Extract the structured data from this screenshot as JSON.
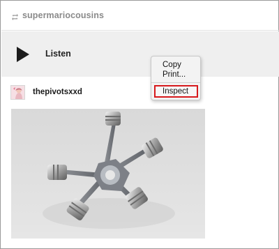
{
  "reblog": {
    "username": "supermariocousins",
    "icon": "reblog-icon"
  },
  "audio": {
    "label": "Listen",
    "icon": "play-icon"
  },
  "post": {
    "author": "thepivotsxxd",
    "image": "engine-pistons-render"
  },
  "context_menu": {
    "items": [
      {
        "label": "Copy"
      },
      {
        "label": "Print..."
      },
      {
        "label": "Inspect",
        "highlighted": true
      }
    ],
    "highlight_color": "#d7191c"
  }
}
